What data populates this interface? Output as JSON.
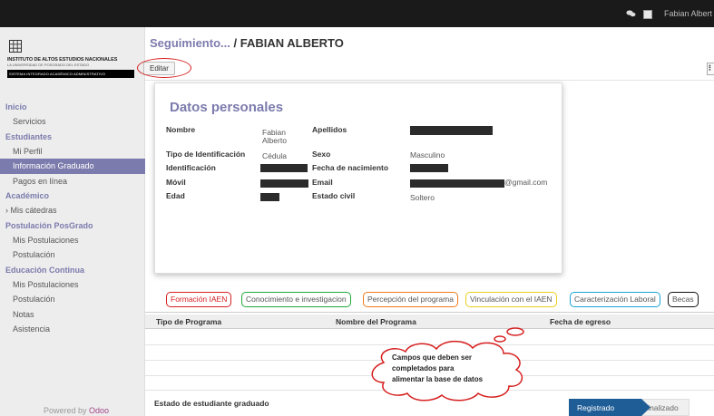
{
  "topbar": {
    "user_name": "Fabian Albert",
    "icons": [
      "chat-icon",
      "avatar"
    ]
  },
  "sidebar": {
    "logo": {
      "line1": "INSTITUTO DE ALTOS ESTUDIOS NACIONALES",
      "line2": "LA UNIVERSIDAD DE POSGRADO DEL ESTADO",
      "band": "SISTEMA INTEGRADO ACADÉMICO ADMINISTRATIVO"
    },
    "sections": [
      {
        "title": "Inicio",
        "items": [
          "Servicios"
        ]
      },
      {
        "title": "Estudiantes",
        "items": [
          "Mi Perfil",
          "Información Graduado",
          "Pagos en línea"
        ]
      },
      {
        "title": "Académico",
        "items": [
          "Mis cátedras"
        ]
      },
      {
        "title": "Postulación PosGrado",
        "items": [
          "Mis Postulaciones",
          "Postulación"
        ]
      },
      {
        "title": "Educación Continua",
        "items": [
          "Mis Postulaciones",
          "Postulación",
          "Notas",
          "Asistencia"
        ]
      }
    ],
    "active_item": "Información Graduado",
    "powered_prefix": "Powered by",
    "powered_brand": "Odoo"
  },
  "breadcrumb": {
    "parent": "Seguimiento...",
    "separator": "/",
    "record": "FABIAN ALBERTO"
  },
  "toolbar": {
    "edit_label": "Editar"
  },
  "form": {
    "title": "Datos personales",
    "labels": {
      "nombre": "Nombre",
      "apellidos": "Apellidos",
      "tipo_id": "Tipo de Identificación",
      "sexo": "Sexo",
      "identificacion": "Identificación",
      "fecha_nac": "Fecha de nacimiento",
      "movil": "Móvil",
      "email": "Email",
      "edad": "Edad",
      "estado_civil": "Estado civil"
    },
    "values": {
      "nombre_1": "Fabian",
      "nombre_2": "Alberto",
      "tipo_id": "Cédula",
      "sexo": "Masculino",
      "email_suffix": "@gmail.com",
      "estado_civil": "Soltero"
    }
  },
  "tabs": [
    {
      "label": "Formación IAEN",
      "color": "#d62020"
    },
    {
      "label": "Conocimiento e investigacion",
      "color": "#22a83a"
    },
    {
      "label": "Percepción del programa",
      "color": "#f07a1a"
    },
    {
      "label": "Vinculación con el IAEN",
      "color": "#e8d020"
    },
    {
      "label": "Caracterización Laboral",
      "color": "#1aa3d6"
    },
    {
      "label": "Becas",
      "color": "#111111"
    }
  ],
  "table": {
    "columns": [
      "Tipo de Programa",
      "Nombre del Programa",
      "Fecha de egreso"
    ]
  },
  "annotation": {
    "line1": "Campos que deben ser",
    "line2": "completados para",
    "line3": "alimentar la base de datos"
  },
  "status": {
    "label": "Estado de estudiante graduado",
    "current": "Registrado",
    "next": "Finalizado",
    "accent": "#1f5d96"
  }
}
